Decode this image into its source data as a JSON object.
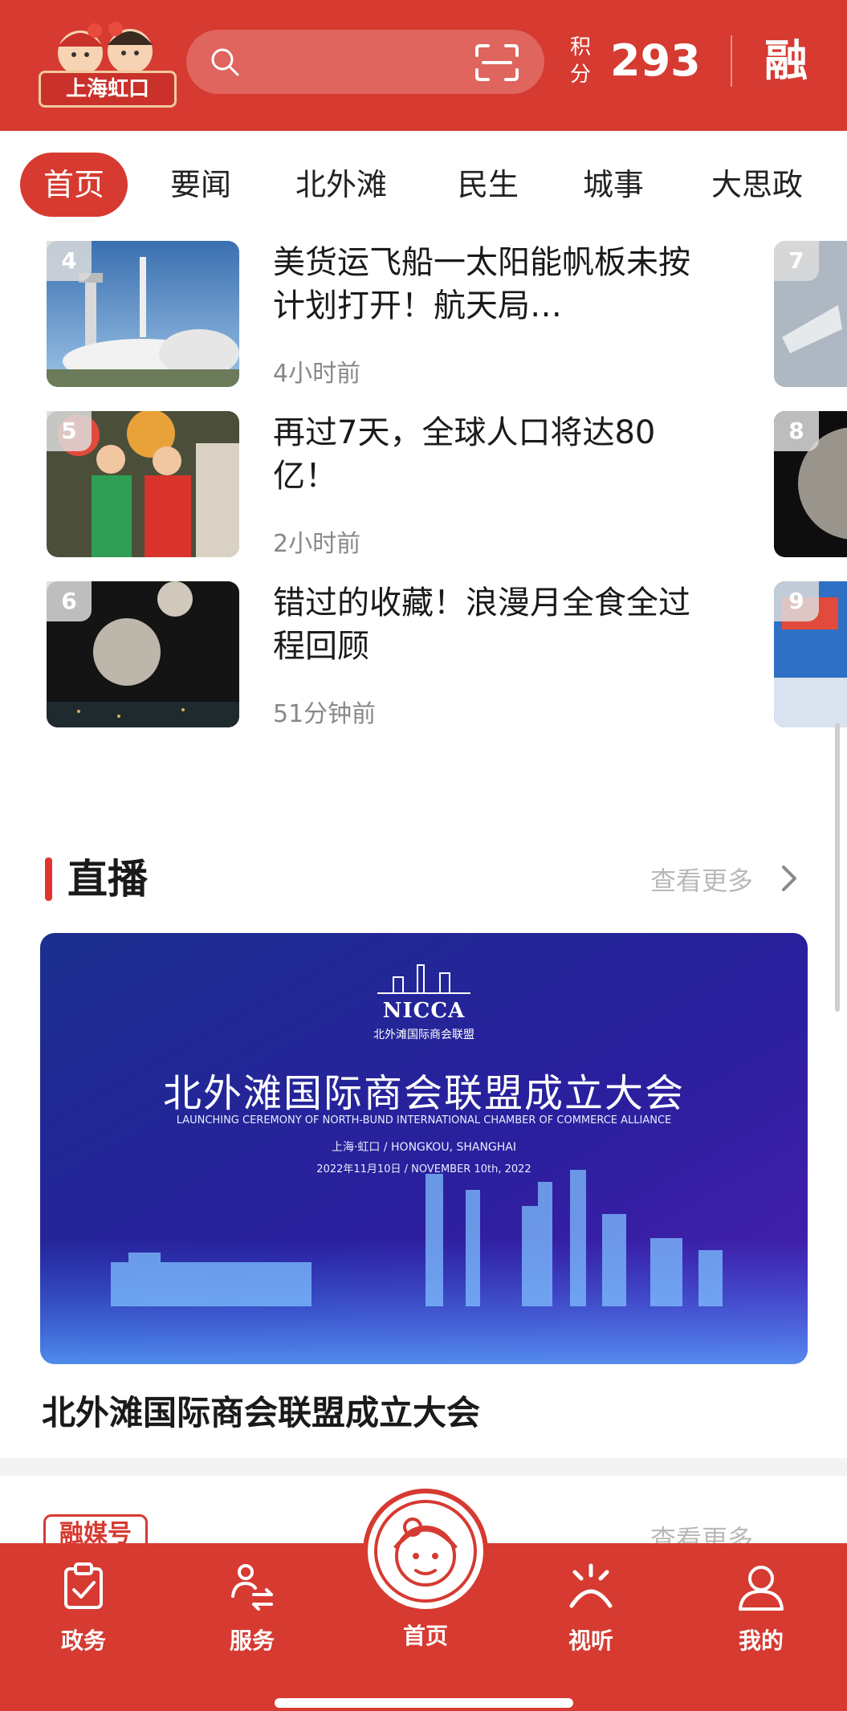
{
  "header": {
    "logo_text": "上海虹口",
    "points_label": "积分",
    "points_value": "293",
    "rong_label": "融"
  },
  "tabs": [
    {
      "label": "首页",
      "active": true
    },
    {
      "label": "要闻",
      "active": false
    },
    {
      "label": "北外滩",
      "active": false
    },
    {
      "label": "民生",
      "active": false
    },
    {
      "label": "城事",
      "active": false
    },
    {
      "label": "大思政",
      "active": false
    }
  ],
  "news": [
    {
      "rank": "4",
      "title": "美货运飞船一太阳能帆板未按计划打开！航天局…",
      "time": "4小时前"
    },
    {
      "rank": "5",
      "title": "再过7天，全球人口将达80亿！",
      "time": "2小时前"
    },
    {
      "rank": "6",
      "title": "错过的收藏！浪漫月全食全过程回顾",
      "time": "51分钟前"
    }
  ],
  "side_ranks": [
    "7",
    "8",
    "9"
  ],
  "live": {
    "section_title": "直播",
    "more": "查看更多",
    "banner": {
      "org": "NICCA",
      "org_cn": "北外滩国际商会联盟",
      "title_cn": "北外滩国际商会联盟成立大会",
      "title_en": "LAUNCHING CEREMONY OF NORTH-BUND INTERNATIONAL CHAMBER OF COMMERCE ALLIANCE",
      "location": "上海·虹口 / HONGKOU, SHANGHAI",
      "date": "2022年11月10日 / NOVEMBER 10th, 2022"
    },
    "caption": "北外滩国际商会联盟成立大会"
  },
  "media": {
    "tag": "融媒号",
    "more": "查看更多"
  },
  "bottom_nav": {
    "items": [
      {
        "label": "政务",
        "icon": "clipboard-check-icon"
      },
      {
        "label": "服务",
        "icon": "service-person-icon"
      },
      {
        "label": "首页",
        "icon": "mascot-home-icon"
      },
      {
        "label": "视听",
        "icon": "broadcast-icon"
      },
      {
        "label": "我的",
        "icon": "user-icon"
      }
    ]
  },
  "colors": {
    "brand_red": "#d63a31",
    "muted_text": "#888888"
  }
}
